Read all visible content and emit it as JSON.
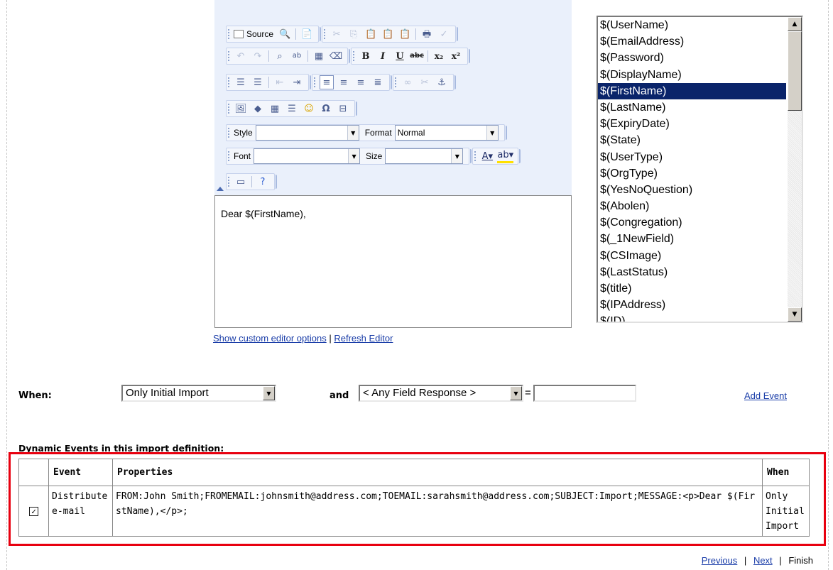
{
  "toolbar": {
    "source_label": "Source",
    "style_label": "Style",
    "style_value": "",
    "format_label": "Format",
    "format_value": "Normal",
    "font_label": "Font",
    "font_value": "",
    "size_label": "Size",
    "size_value": ""
  },
  "editor": {
    "content": "Dear $(FirstName),",
    "show_custom_options_link": "Show custom editor options",
    "separator": "|",
    "refresh_link": "Refresh Editor"
  },
  "placeholders": {
    "items": [
      "$(UserName)",
      "$(EmailAddress)",
      "$(Password)",
      "$(DisplayName)",
      "$(FirstName)",
      "$(LastName)",
      "$(ExpiryDate)",
      "$(State)",
      "$(UserType)",
      "$(OrgType)",
      "$(YesNoQuestion)",
      "$(Abolen)",
      "$(Congregation)",
      "$(_1NewField)",
      "$(CSImage)",
      "$(LastStatus)",
      "$(title)",
      "$(IPAddress)",
      "$(ID)"
    ],
    "selected": "$(FirstName)"
  },
  "when_row": {
    "when_label": "When:",
    "when_value": "Only Initial Import",
    "and_label": "and",
    "field_value": "< Any Field Response >",
    "equals": "=",
    "text_value": "",
    "add_event_link": "Add Event"
  },
  "events": {
    "section_title": "Dynamic Events in this import definition:",
    "columns": [
      "",
      "Event",
      "Properties",
      "When"
    ],
    "rows": [
      {
        "checked": true,
        "event": "Distribute e-mail",
        "properties": "FROM:John Smith;FROMEMAIL:johnsmith@address.com;TOEMAIL:sarahsmith@address.com;SUBJECT:Import;MESSAGE:<p>Dear $(FirstName),</p>;",
        "when": "Only Initial Import"
      }
    ]
  },
  "nav": {
    "previous": "Previous",
    "sep1": "|",
    "next": "Next",
    "sep2": "|",
    "finish": "Finish"
  }
}
